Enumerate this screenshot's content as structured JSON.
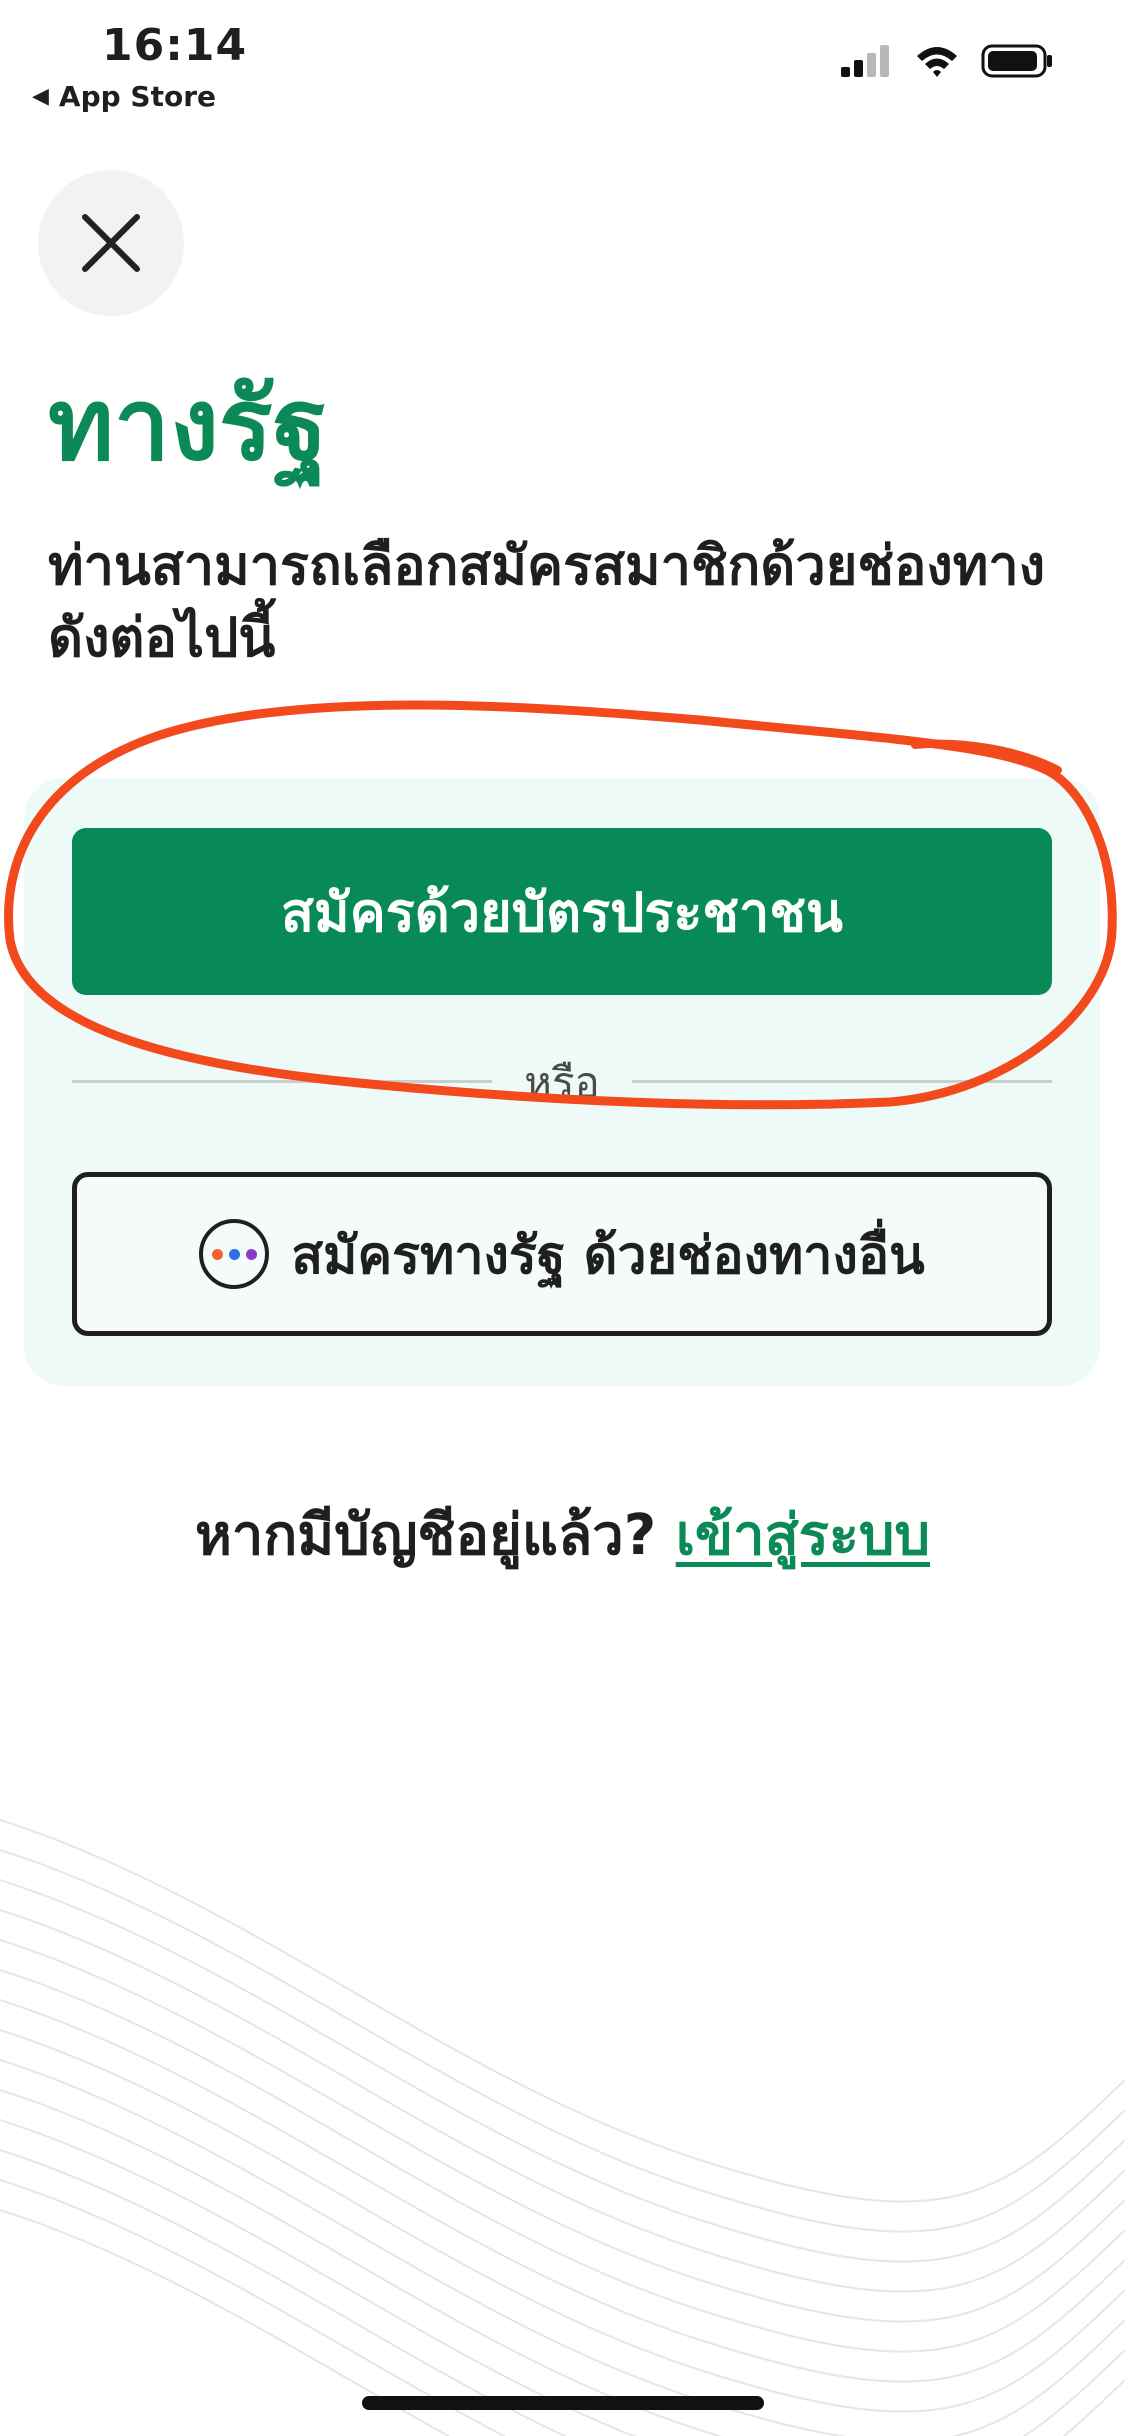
{
  "status_bar": {
    "time": "16:14",
    "back_label": "App Store",
    "back_icon": "back-triangle-icon",
    "icons": [
      "cellular-signal-icon",
      "wifi-icon",
      "battery-icon"
    ]
  },
  "close_button": {
    "icon": "close-icon"
  },
  "header": {
    "title": "ทางรัฐ",
    "subtitle": "ท่านสามารถเลือกสมัครสมาชิกด้วยช่องทางดังต่อไปนี้"
  },
  "signup": {
    "primary_label": "สมัครด้วยบัตรประชาชน",
    "divider_label": "หรือ",
    "secondary_label": "สมัครทางรัฐ ด้วยช่องทางอื่น",
    "secondary_icon": "more-options-icon"
  },
  "login": {
    "prompt": "หากมีบัญชีอยู่แล้ว?",
    "link_label": "เข้าสู่ระบบ"
  },
  "colors": {
    "brand_green": "#0b8a57",
    "button_green": "#078a58",
    "card_bg": "#eefaf8",
    "annotation_red": "#f24a1d"
  }
}
